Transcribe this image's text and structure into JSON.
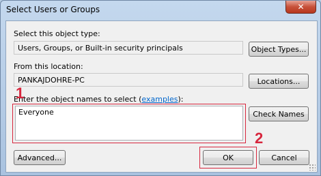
{
  "window": {
    "title": "Select Users or Groups",
    "close_label": "✕"
  },
  "object_type": {
    "label": "Select this object type:",
    "value": "Users, Groups, or Built-in security principals",
    "button": "Object Types..."
  },
  "location": {
    "label": "From this location:",
    "value": "PANKAJDOHRE-PC",
    "button": "Locations..."
  },
  "names": {
    "label_prefix": "Enter the object names to select (",
    "label_link": "examples",
    "label_suffix": "):",
    "value": "Everyone",
    "check_button": "Check Names"
  },
  "footer": {
    "advanced_button": "Advanced...",
    "ok_button": "OK",
    "cancel_button": "Cancel"
  },
  "annotations": {
    "step1": "1",
    "step2": "2",
    "color": "#d7263d"
  }
}
